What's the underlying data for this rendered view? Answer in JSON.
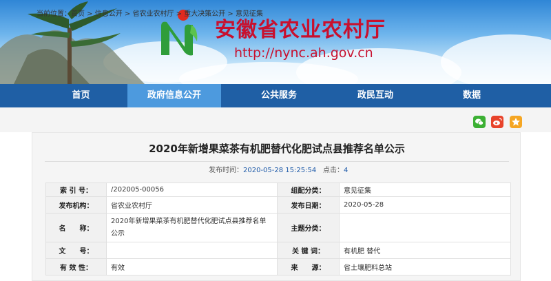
{
  "site": {
    "title": "安徽省农业农村厅",
    "url": "http://nync.ah.gov.cn"
  },
  "nav": {
    "items": [
      {
        "label": "首页"
      },
      {
        "label": "政府信息公开"
      },
      {
        "label": "公共服务"
      },
      {
        "label": "政民互动"
      },
      {
        "label": "数据"
      }
    ]
  },
  "breadcrumb": {
    "prefix": "当前位置：",
    "items": [
      "首页",
      "信息公开",
      "省农业农村厅",
      "重大决策公开",
      "意见征集"
    ],
    "separator": " > "
  },
  "share": {
    "icons": [
      "wechat-icon",
      "weibo-icon",
      "qzone-icon"
    ]
  },
  "article": {
    "title": "2020年新增果菜茶有机肥替代化肥试点县推荐名单公示",
    "publish_label": "发布时间：",
    "publish_time": "2020-05-28 15:25:54",
    "views_label": "点击：",
    "views": "4"
  },
  "info_table": {
    "rows": [
      {
        "l1": "索 引 号：",
        "v1": "/202005-00056",
        "l2": "组配分类：",
        "v2": "意见征集"
      },
      {
        "l1": "发布机构：",
        "v1": "省农业农村厅",
        "l2": "发布日期：",
        "v2": "2020-05-28"
      },
      {
        "l1": "名　　称：",
        "v1": "2020年新增果菜茶有机肥替代化肥试点县推荐名单公示",
        "l2": "主题分类：",
        "v2": ""
      },
      {
        "l1": "文　　号：",
        "v1": "",
        "l2": "关 键 词：",
        "v2": "有机肥 替代"
      },
      {
        "l1": "有 效 性：",
        "v1": "有效",
        "l2": "来　　源：",
        "v2": "省土壤肥料总站"
      }
    ]
  },
  "colors": {
    "brand_red": "#c8102e",
    "nav_blue": "#1f5fa5",
    "nav_active": "#4d9ade"
  }
}
